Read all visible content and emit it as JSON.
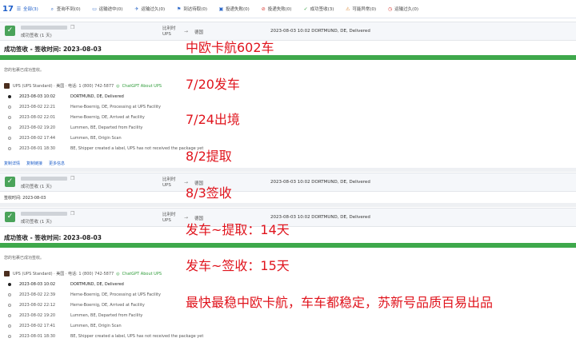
{
  "topbar": {
    "logo": "17",
    "tabs": [
      {
        "label": "全部(3)",
        "icon": "list-icon",
        "active": true
      },
      {
        "label": "查询不到(0)",
        "icon": "search-icon"
      },
      {
        "label": "运输途中(0)",
        "icon": "truck-icon"
      },
      {
        "label": "运输过久(0)",
        "icon": "plane-icon"
      },
      {
        "label": "到达待取(0)",
        "icon": "flag-icon"
      },
      {
        "label": "投递失败(0)",
        "icon": "box-icon"
      },
      {
        "label": "投递失败(0)",
        "icon": "alert-icon"
      },
      {
        "label": "成功签收(3)",
        "icon": "check-icon"
      },
      {
        "label": "可能异常(0)",
        "icon": "warning-icon"
      },
      {
        "label": "运输过久(0)",
        "icon": "clock-icon"
      }
    ]
  },
  "card1": {
    "substatus": "成功签收 (1 天)",
    "carrier": [
      "比利时",
      "UPS"
    ],
    "arrow": "→",
    "dest": "德国",
    "latest_event": "2023-08-03 10:02  DORTMUND, DE, Delivered",
    "status_title": "成功签收 - 签收时间:  2023-08-03",
    "note": "您的包裹已成功签收。",
    "carrier_line": "UPS (UPS Standard) · 美国 · 电话: 1 (800) 742-5877",
    "gpt_label": "ChatGPT About UPS",
    "events": [
      {
        "time": "2023-08-03 10:02",
        "text": "DORTMUND, DE, Delivered"
      },
      {
        "time": "2023-08-02 22:21",
        "text": "Herne-Boernig, DE, Processing at UPS Facility"
      },
      {
        "time": "2023-08-02 22:01",
        "text": "Herne-Boernig, DE, Arrived at Facility"
      },
      {
        "time": "2023-08-02 19:20",
        "text": "Lummen, BE, Departed from Facility"
      },
      {
        "time": "2023-08-02 17:44",
        "text": "Lummen, BE, Origin Scan"
      },
      {
        "time": "2023-08-01 18:30",
        "text": "BE, Shipper created a label, UPS has not received the package yet"
      }
    ],
    "actions": [
      "复制详情",
      "复制链接",
      "更多信息"
    ]
  },
  "card2": {
    "substatus": "成功签收 (1 天)",
    "carrier": [
      "比利时",
      "UPS"
    ],
    "arrow": "→",
    "dest": "德国",
    "latest_event": "2023-08-03 10:02  DORTMUND, DE, Delivered",
    "status_title": "签收时间:  2023-08-03"
  },
  "card3": {
    "substatus": "成功签收 (1 天)",
    "carrier": [
      "比利时",
      "UPS"
    ],
    "arrow": "→",
    "dest": "德国",
    "latest_event": "2023-08-03 10:02  DORTMUND, DE, Delivered",
    "status_title": "成功签收 - 签收时间:  2023-08-03",
    "note": "您的包裹已成功签收。",
    "carrier_line": "UPS (UPS Standard) · 美国 · 电话: 1 (800) 742-5877",
    "gpt_label": "ChatGPT About UPS",
    "events": [
      {
        "time": "2023-08-03 10:02",
        "text": "DORTMUND, DE, Delivered"
      },
      {
        "time": "2023-08-02 22:39",
        "text": "Herne-Boernig, DE, Processing at UPS Facility"
      },
      {
        "time": "2023-08-02 22:12",
        "text": "Herne-Boernig, DE, Arrived at Facility"
      },
      {
        "time": "2023-08-02 19:20",
        "text": "Lummen, BE, Departed from Facility"
      },
      {
        "time": "2023-08-02 17:41",
        "text": "Lummen, BE, Origin Scan"
      },
      {
        "time": "2023-08-01 18:30",
        "text": "BE, Shipper created a label, UPS has not received the package yet"
      }
    ]
  },
  "annotations": {
    "a1": "中欧卡航602车",
    "a2": "7/20发车",
    "a3": "7/24出境",
    "a4": "8/2提取",
    "a5": "8/3签收",
    "a6": "发车~提取：14天",
    "a7": "发车~签收：15天",
    "a8": "最快最稳中欧卡航，车车都稳定，苏新号品质百易出品"
  },
  "colors": {
    "accent": "#1c5dc9",
    "progress": "#3ea84b",
    "annotation": "#e0141d"
  }
}
